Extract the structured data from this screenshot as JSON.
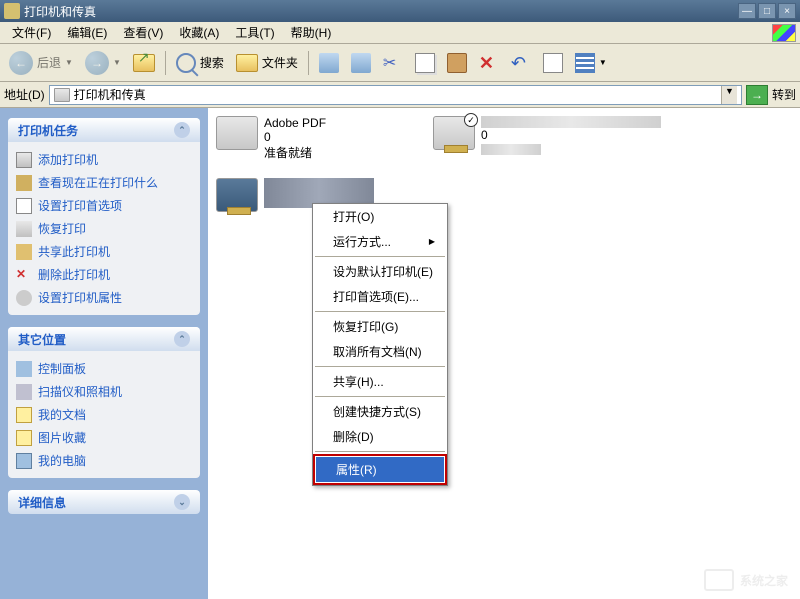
{
  "window": {
    "title": "打印机和传真"
  },
  "menu": {
    "file": "文件(F)",
    "edit": "编辑(E)",
    "view": "查看(V)",
    "favorites": "收藏(A)",
    "tools": "工具(T)",
    "help": "帮助(H)"
  },
  "toolbar": {
    "back": "后退",
    "search": "搜索",
    "folders": "文件夹"
  },
  "address": {
    "label": "地址(D)",
    "value": "打印机和传真",
    "go": "转到"
  },
  "sidebar": {
    "tasks": {
      "title": "打印机任务",
      "items": [
        "添加打印机",
        "查看现在正在打印什么",
        "设置打印首选项",
        "恢复打印",
        "共享此打印机",
        "删除此打印机",
        "设置打印机属性"
      ]
    },
    "other": {
      "title": "其它位置",
      "items": [
        "控制面板",
        "扫描仪和照相机",
        "我的文档",
        "图片收藏",
        "我的电脑"
      ]
    },
    "details": {
      "title": "详细信息"
    }
  },
  "printers": [
    {
      "name": "Adobe PDF",
      "docs": "0",
      "status": "准备就绪"
    },
    {
      "name": "",
      "docs": "0",
      "status": ""
    },
    {
      "name": "",
      "docs": "",
      "status": ""
    }
  ],
  "context_menu": {
    "open": "打开(O)",
    "runas": "运行方式...",
    "setdefault": "设为默认打印机(E)",
    "prefs": "打印首选项(E)...",
    "resume": "恢复打印(G)",
    "cancelall": "取消所有文档(N)",
    "share": "共享(H)...",
    "shortcut": "创建快捷方式(S)",
    "delete": "删除(D)",
    "properties": "属性(R)"
  },
  "watermark": "系统之家"
}
